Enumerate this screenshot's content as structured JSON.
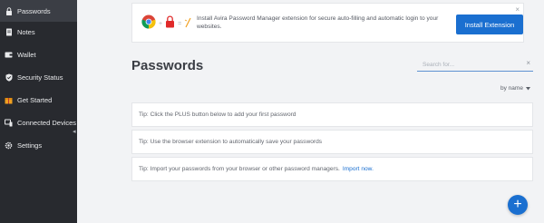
{
  "sidebar": {
    "items": [
      {
        "label": "Passwords",
        "icon": "lock-icon",
        "active": true
      },
      {
        "label": "Notes",
        "icon": "note-icon",
        "active": false
      },
      {
        "label": "Wallet",
        "icon": "wallet-icon",
        "active": false
      },
      {
        "label": "Security Status",
        "icon": "shield-check-icon",
        "active": false
      },
      {
        "label": "Get Started",
        "icon": "gift-icon",
        "active": false
      },
      {
        "label": "Connected Devices",
        "icon": "devices-icon",
        "active": false
      },
      {
        "label": "Settings",
        "icon": "gear-icon",
        "active": false
      }
    ]
  },
  "banner": {
    "text": "Install Avira Password Manager extension for secure auto-filling and automatic login to your websites.",
    "button_label": "Install Extension",
    "close_label": "×"
  },
  "main": {
    "title": "Passwords",
    "search_placeholder": "Search for...",
    "search_clear": "×",
    "sort_label": "by name"
  },
  "tips": [
    {
      "text": "Tip: Click the PLUS button below to add your first password",
      "link": ""
    },
    {
      "text": "Tip: Use the browser extension to automatically save your passwords",
      "link": ""
    },
    {
      "text": "Tip: Import your passwords from your browser or other password managers.",
      "link": "Import now."
    }
  ],
  "fab": {
    "label": "+"
  },
  "colors": {
    "sidebar_bg": "#282a2f",
    "sidebar_active": "#3b3e45",
    "accent": "#1a6fd0",
    "background": "#f2f3f5"
  }
}
